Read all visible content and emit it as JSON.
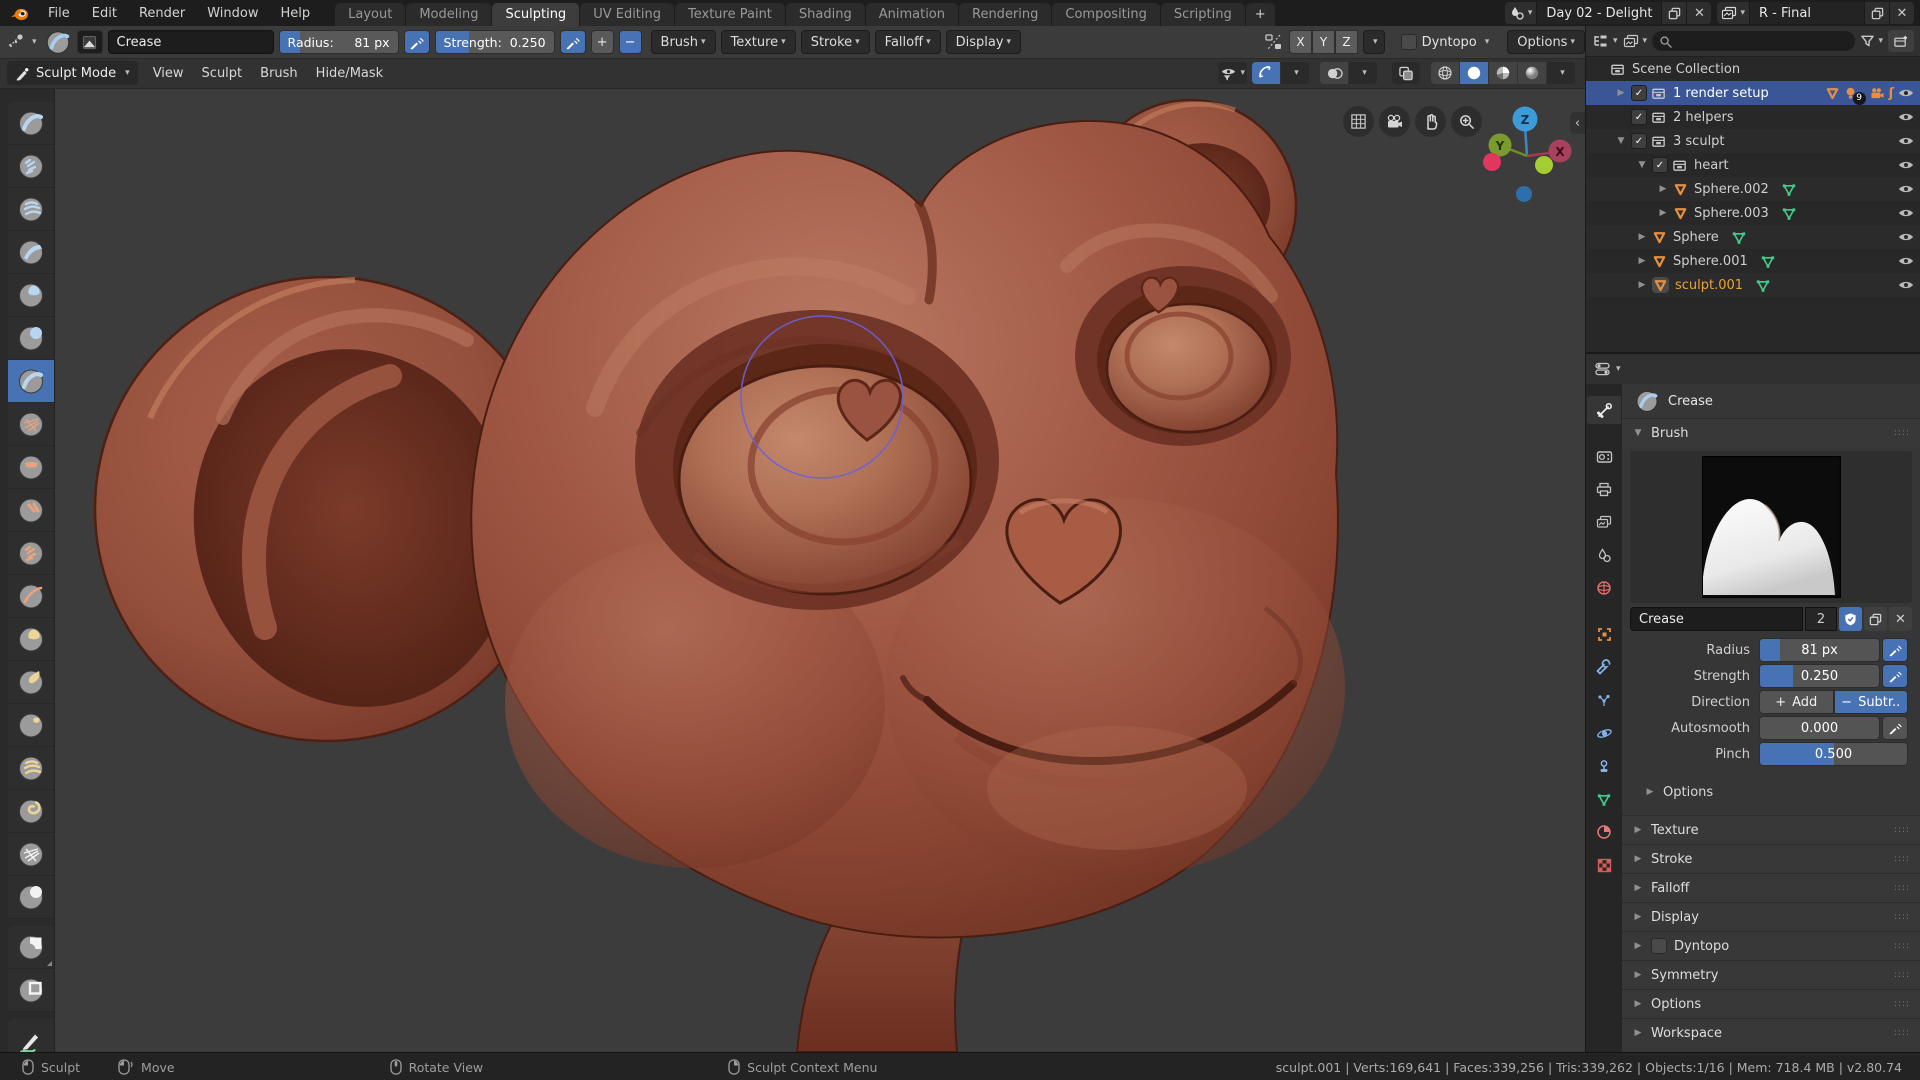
{
  "colors": {
    "accent": "#4772b3",
    "selection": "#3b5697",
    "orange": "#e78f3f",
    "green": "#3ecf8e",
    "brush_cursor": "#6a60d8"
  },
  "menubar": {
    "menus": [
      "File",
      "Edit",
      "Render",
      "Window",
      "Help"
    ]
  },
  "workspaces": {
    "tabs": [
      {
        "label": "Layout",
        "active": false
      },
      {
        "label": "Modeling",
        "active": false
      },
      {
        "label": "Sculpting",
        "active": true
      },
      {
        "label": "UV Editing",
        "active": false
      },
      {
        "label": "Texture Paint",
        "active": false
      },
      {
        "label": "Shading",
        "active": false
      },
      {
        "label": "Animation",
        "active": false
      },
      {
        "label": "Rendering",
        "active": false
      },
      {
        "label": "Compositing",
        "active": false
      },
      {
        "label": "Scripting",
        "active": false
      }
    ],
    "add_label": "+"
  },
  "scene_widget": {
    "value": "Day 02 - Delight"
  },
  "view_layer_widget": {
    "value": "R - Final"
  },
  "tool_settings": {
    "brush_name": "Crease",
    "radius": {
      "label": "Radius:",
      "value": "81 px",
      "fill": 0.17
    },
    "strength": {
      "label": "Strength:",
      "value": "0.250",
      "fill": 0.28
    },
    "add_label": "+",
    "subtract_label": "−",
    "popovers": [
      "Brush",
      "Texture",
      "Stroke",
      "Falloff",
      "Display"
    ],
    "symmetry_axes": [
      "X",
      "Y",
      "Z"
    ],
    "dyntopo_label": "Dyntopo",
    "options_label": "Options"
  },
  "viewport_header": {
    "mode": "Sculpt Mode",
    "menus": [
      "View",
      "Sculpt",
      "Brush",
      "Hide/Mask"
    ]
  },
  "sculpt_tools": [
    {
      "name": "draw",
      "accent": "blue",
      "variant": "arc"
    },
    {
      "name": "clay",
      "accent": "blue",
      "variant": "scribble"
    },
    {
      "name": "clay-strips",
      "accent": "blue",
      "variant": "stripes"
    },
    {
      "name": "layer",
      "accent": "blue",
      "variant": "band"
    },
    {
      "name": "inflate",
      "accent": "blue",
      "variant": "cap"
    },
    {
      "name": "blob",
      "accent": "blue",
      "variant": "ball"
    },
    {
      "name": "crease",
      "accent": "blue",
      "variant": "arc",
      "selected": true
    },
    {
      "name": "smooth",
      "accent": "orange",
      "variant": "web"
    },
    {
      "name": "flatten",
      "accent": "orange",
      "variant": "flat"
    },
    {
      "name": "fill",
      "accent": "orange",
      "variant": "marks"
    },
    {
      "name": "scrape",
      "accent": "orange",
      "variant": "scribble"
    },
    {
      "name": "pinch",
      "accent": "orange",
      "variant": "line"
    },
    {
      "name": "grab",
      "accent": "yellow",
      "variant": "cap"
    },
    {
      "name": "snake-hook",
      "accent": "yellow",
      "variant": "pull"
    },
    {
      "name": "thumb",
      "accent": "yellow",
      "variant": "nub"
    },
    {
      "name": "nudge",
      "accent": "yellow",
      "variant": "stripes"
    },
    {
      "name": "rotate",
      "accent": "yellow",
      "variant": "swirl"
    },
    {
      "name": "slide-relax",
      "accent": "white",
      "variant": "web"
    },
    {
      "name": "mask",
      "accent": "white",
      "variant": "ball"
    },
    {
      "name": "box-mask",
      "accent": "white",
      "variant": "corner",
      "gap": true,
      "submenu": true
    },
    {
      "name": "box-hide",
      "accent": "white",
      "variant": "square"
    },
    {
      "name": "annotate",
      "accent": "green",
      "variant": "pen",
      "gap": true,
      "submenu": true
    }
  ],
  "gizmo": {
    "z": "Z",
    "y": "Y",
    "x": "X"
  },
  "outliner": {
    "search_placeholder": "",
    "rows": [
      {
        "label": "Scene Collection",
        "depth": 0,
        "type": "collection",
        "disclosure": "none",
        "checkbox": false,
        "eye": false
      },
      {
        "label": "1 render setup",
        "depth": 1,
        "type": "collection",
        "disclosure": "right",
        "checkbox": true,
        "selected": true,
        "eye": true,
        "extras": [
          "mesh",
          "bulb",
          "camera",
          "force"
        ],
        "badge": "9"
      },
      {
        "label": "2 helpers",
        "depth": 1,
        "type": "collection",
        "disclosure": "none",
        "checkbox": true,
        "eye": true
      },
      {
        "label": "3 sculpt",
        "depth": 1,
        "type": "collection",
        "disclosure": "down",
        "checkbox": true,
        "eye": true
      },
      {
        "label": "heart",
        "depth": 2,
        "type": "collection",
        "disclosure": "down",
        "checkbox": true,
        "eye": true
      },
      {
        "label": "Sphere.002",
        "depth": 3,
        "type": "mesh",
        "disclosure": "right",
        "checkbox": false,
        "eye": true,
        "data_icon": true
      },
      {
        "label": "Sphere.003",
        "depth": 3,
        "type": "mesh",
        "disclosure": "right",
        "checkbox": false,
        "eye": true,
        "data_icon": true
      },
      {
        "label": "Sphere",
        "depth": 2,
        "type": "mesh",
        "disclosure": "right",
        "checkbox": false,
        "eye": true,
        "data_icon": true
      },
      {
        "label": "Sphere.001",
        "depth": 2,
        "type": "mesh",
        "disclosure": "right",
        "checkbox": false,
        "eye": true,
        "data_icon": true
      },
      {
        "label": "sculpt.001",
        "depth": 2,
        "type": "mesh",
        "disclosure": "right",
        "checkbox": false,
        "eye": true,
        "data_icon": true,
        "active": true
      }
    ]
  },
  "properties": {
    "breadcrumb": "Crease",
    "tabs": [
      {
        "name": "tool",
        "active": true
      },
      {
        "name": "render",
        "group": true
      },
      {
        "name": "output"
      },
      {
        "name": "view-layer"
      },
      {
        "name": "scene"
      },
      {
        "name": "world"
      },
      {
        "name": "object",
        "group": true
      },
      {
        "name": "modifiers"
      },
      {
        "name": "particles"
      },
      {
        "name": "physics"
      },
      {
        "name": "constraints"
      },
      {
        "name": "data"
      },
      {
        "name": "material"
      },
      {
        "name": "texture"
      }
    ],
    "brush_panel": {
      "title": "Brush",
      "name_value": "Crease",
      "users_count": "2",
      "fields": [
        {
          "label": "Radius",
          "type": "slider",
          "value": "81 px",
          "fill": 0.17,
          "pressure": true,
          "pressure_on": true
        },
        {
          "label": "Strength",
          "type": "slider",
          "value": "0.250",
          "fill": 0.28,
          "pressure": true,
          "pressure_on": true
        },
        {
          "label": "Direction",
          "type": "segment",
          "options": [
            {
              "prefix": "+",
              "label": "Add",
              "selected": false
            },
            {
              "prefix": "−",
              "label": "Subtr..",
              "selected": true
            }
          ]
        },
        {
          "label": "Autosmooth",
          "type": "slider",
          "value": "0.000",
          "fill": 0,
          "pressure": true,
          "pressure_on": false
        },
        {
          "label": "Pinch",
          "type": "slider",
          "value": "0.500",
          "fill": 0.5,
          "pressure": false
        }
      ],
      "subpanel": "Options"
    },
    "collapsed_panels": [
      {
        "label": "Texture"
      },
      {
        "label": "Stroke"
      },
      {
        "label": "Falloff"
      },
      {
        "label": "Display"
      },
      {
        "label": "Dyntopo",
        "checkbox": true
      },
      {
        "label": "Symmetry"
      },
      {
        "label": "Options"
      },
      {
        "label": "Workspace"
      }
    ]
  },
  "statusbar": {
    "hints": [
      {
        "icon": "mouse-left",
        "label": "Sculpt"
      },
      {
        "icon": "mouse-left-drag",
        "label": "Move"
      },
      {
        "icon": "mouse-middle",
        "label": "Rotate View"
      },
      {
        "icon": "mouse-right",
        "label": "Sculpt Context Menu"
      }
    ],
    "stats": "sculpt.001 | Verts:169,641 | Faces:339,256 | Tris:339,262 | Objects:1/16 | Mem: 718.4 MB | v2.80.74"
  }
}
